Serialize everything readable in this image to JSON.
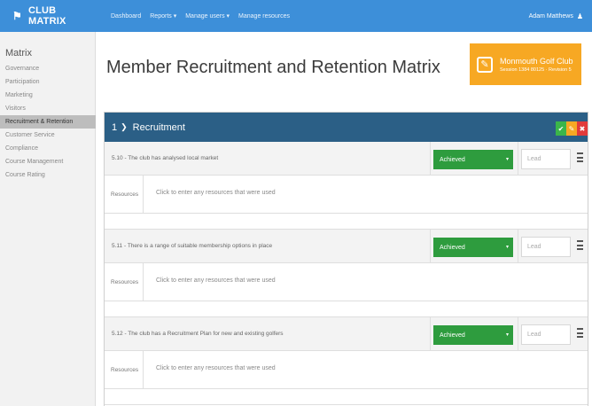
{
  "app": {
    "brand": "CLUB MATRIX"
  },
  "nav": {
    "items": [
      "Dashboard",
      "Reports ▾",
      "Manage users ▾",
      "Manage resources"
    ]
  },
  "user": {
    "name": "Adam Matthews"
  },
  "sidebar": {
    "title": "Matrix",
    "items": [
      {
        "label": "Governance",
        "active": false
      },
      {
        "label": "Participation",
        "active": false
      },
      {
        "label": "Marketing",
        "active": false
      },
      {
        "label": "Visitors",
        "active": false
      },
      {
        "label": "Recruitment & Retention",
        "active": true
      },
      {
        "label": "Customer Service",
        "active": false
      },
      {
        "label": "Compliance",
        "active": false
      },
      {
        "label": "Course Management",
        "active": false
      },
      {
        "label": "Course Rating",
        "active": false
      }
    ]
  },
  "page": {
    "title": "Member Recruitment and Retention Matrix"
  },
  "club": {
    "name": "Monmouth Golf Club",
    "session": "Session 1384 80125 · Revision 5"
  },
  "panel": {
    "number": "1",
    "title": "Recruitment",
    "questions": [
      {
        "text": "5.10 - The club has analysed local market",
        "status": "Achieved",
        "lead_placeholder": "Lead",
        "resource_label": "Resources",
        "resource_placeholder": "Click to enter any resources that were used"
      },
      {
        "text": "5.11 - There is a range of suitable membership options in place",
        "status": "Achieved",
        "lead_placeholder": "Lead",
        "resource_label": "Resources",
        "resource_placeholder": "Click to enter any resources that were used"
      },
      {
        "text": "5.12 - The club has a Recruitment Plan for new and existing golfers",
        "status": "Achieved",
        "lead_placeholder": "Lead",
        "resource_label": "Resources",
        "resource_placeholder": "Click to enter any resources that were used"
      }
    ]
  },
  "colors": {
    "topbar": "#3d8fd9",
    "panel_header": "#2b5f86",
    "achieved": "#2e9c3e",
    "club_badge": "#f7a823",
    "ok": "#3bb54a",
    "delete": "#e23b3b"
  }
}
